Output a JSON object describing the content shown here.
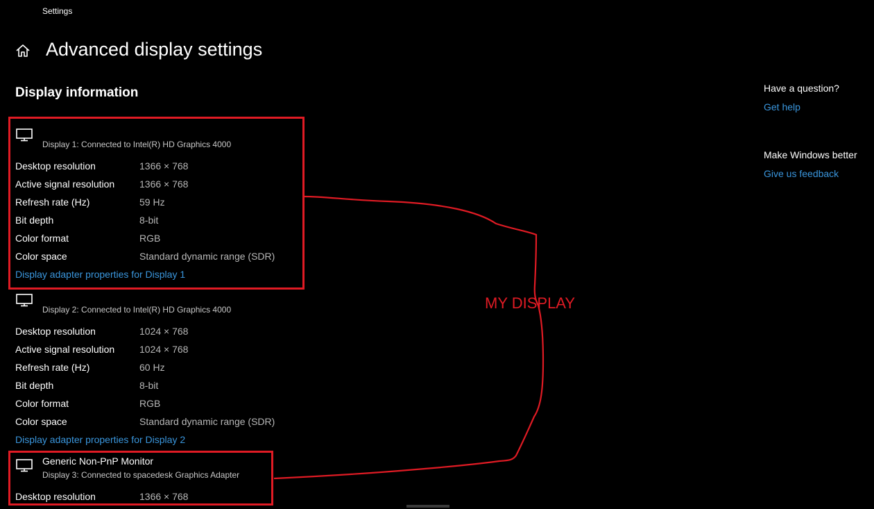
{
  "window": {
    "title": "Settings"
  },
  "header": {
    "title": "Advanced display settings",
    "home_icon": "home-icon"
  },
  "section": {
    "title": "Display information"
  },
  "displays": [
    {
      "name": "",
      "subtitle": "Display 1: Connected to Intel(R) HD Graphics 4000",
      "props": [
        {
          "label": "Desktop resolution",
          "value": "1366 × 768"
        },
        {
          "label": "Active signal resolution",
          "value": "1366 × 768"
        },
        {
          "label": "Refresh rate (Hz)",
          "value": "59 Hz"
        },
        {
          "label": "Bit depth",
          "value": "8-bit"
        },
        {
          "label": "Color format",
          "value": "RGB"
        },
        {
          "label": "Color space",
          "value": "Standard dynamic range (SDR)"
        }
      ],
      "link": "Display adapter properties for Display 1"
    },
    {
      "name": "",
      "subtitle": "Display 2: Connected to Intel(R) HD Graphics 4000",
      "props": [
        {
          "label": "Desktop resolution",
          "value": "1024 × 768"
        },
        {
          "label": "Active signal resolution",
          "value": "1024 × 768"
        },
        {
          "label": "Refresh rate (Hz)",
          "value": "60 Hz"
        },
        {
          "label": "Bit depth",
          "value": "8-bit"
        },
        {
          "label": "Color format",
          "value": "RGB"
        },
        {
          "label": "Color space",
          "value": "Standard dynamic range (SDR)"
        }
      ],
      "link": "Display adapter properties for Display 2"
    },
    {
      "name": "Generic Non-PnP Monitor",
      "subtitle": "Display 3: Connected to spacedesk Graphics Adapter",
      "props": [
        {
          "label": "Desktop resolution",
          "value": "1366 × 768"
        }
      ]
    }
  ],
  "sidebar": {
    "question_title": "Have a question?",
    "get_help": "Get help",
    "better_title": "Make Windows better",
    "feedback": "Give us feedback"
  },
  "annotation": {
    "text": "MY DISPLAY",
    "color": "#e01b24"
  },
  "colors": {
    "link": "#3a96dd",
    "background": "#000000"
  }
}
